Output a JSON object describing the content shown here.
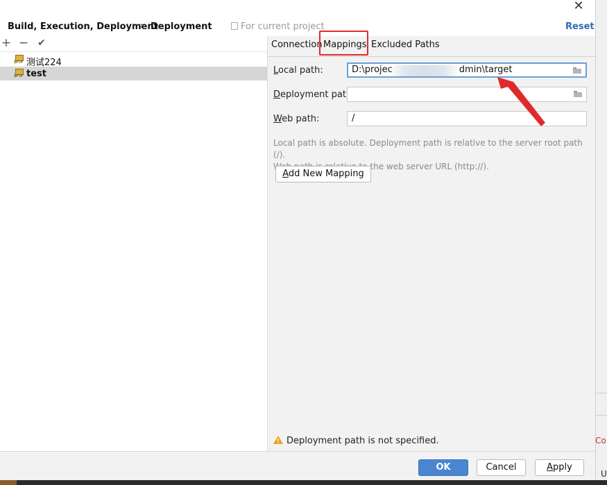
{
  "header": {
    "crumb1": "Build, Execution, Deployment",
    "separator": "›",
    "crumb2": "Deployment",
    "scope_label": "For current project",
    "reset_label": "Reset",
    "close_glyph": "✕"
  },
  "toolbar": {
    "add_glyph": "+",
    "remove_glyph": "−",
    "check_glyph": "✔"
  },
  "servers": [
    {
      "label": "测试224",
      "icon": "sftp-icon",
      "selected": false
    },
    {
      "label": "test",
      "icon": "sftp-icon",
      "selected": true
    }
  ],
  "sftp_icon_text": "SFTP",
  "tabs": [
    {
      "label": "Connection",
      "active": false
    },
    {
      "label": "Mappings",
      "active": true
    },
    {
      "label": "Excluded Paths",
      "active": false
    }
  ],
  "mapping": {
    "local_path_label_pre": "",
    "local_path_label_mn": "L",
    "local_path_label_post": "ocal path:",
    "local_path_value_start": "D:\\projec",
    "local_path_value_end": "dmin\\target",
    "deployment_path_label_pre": "",
    "deployment_path_label_mn": "D",
    "deployment_path_label_post": "eployment path:",
    "deployment_path_value": "",
    "web_path_label_pre": "",
    "web_path_label_mn": "W",
    "web_path_label_post": "eb path:",
    "web_path_value": "/",
    "hint_line1": "Local path is absolute. Deployment path is relative to the server root path (/).",
    "hint_line2": "Web path is relative to the web server URL (http://).",
    "add_button_pre": "",
    "add_button_mn": "A",
    "add_button_post": "dd New Mapping"
  },
  "warning_text": "Deployment path is not specified.",
  "footer": {
    "ok_label": "OK",
    "cancel_label": "Cancel",
    "apply_mn": "A",
    "apply_post": "pply"
  },
  "background": {
    "co_text": "Co",
    "u_text": "U"
  },
  "colors": {
    "accent": "#4a86d0",
    "link": "#2e6db4",
    "annotation": "#e02a2a",
    "warning": "#e8a317"
  }
}
